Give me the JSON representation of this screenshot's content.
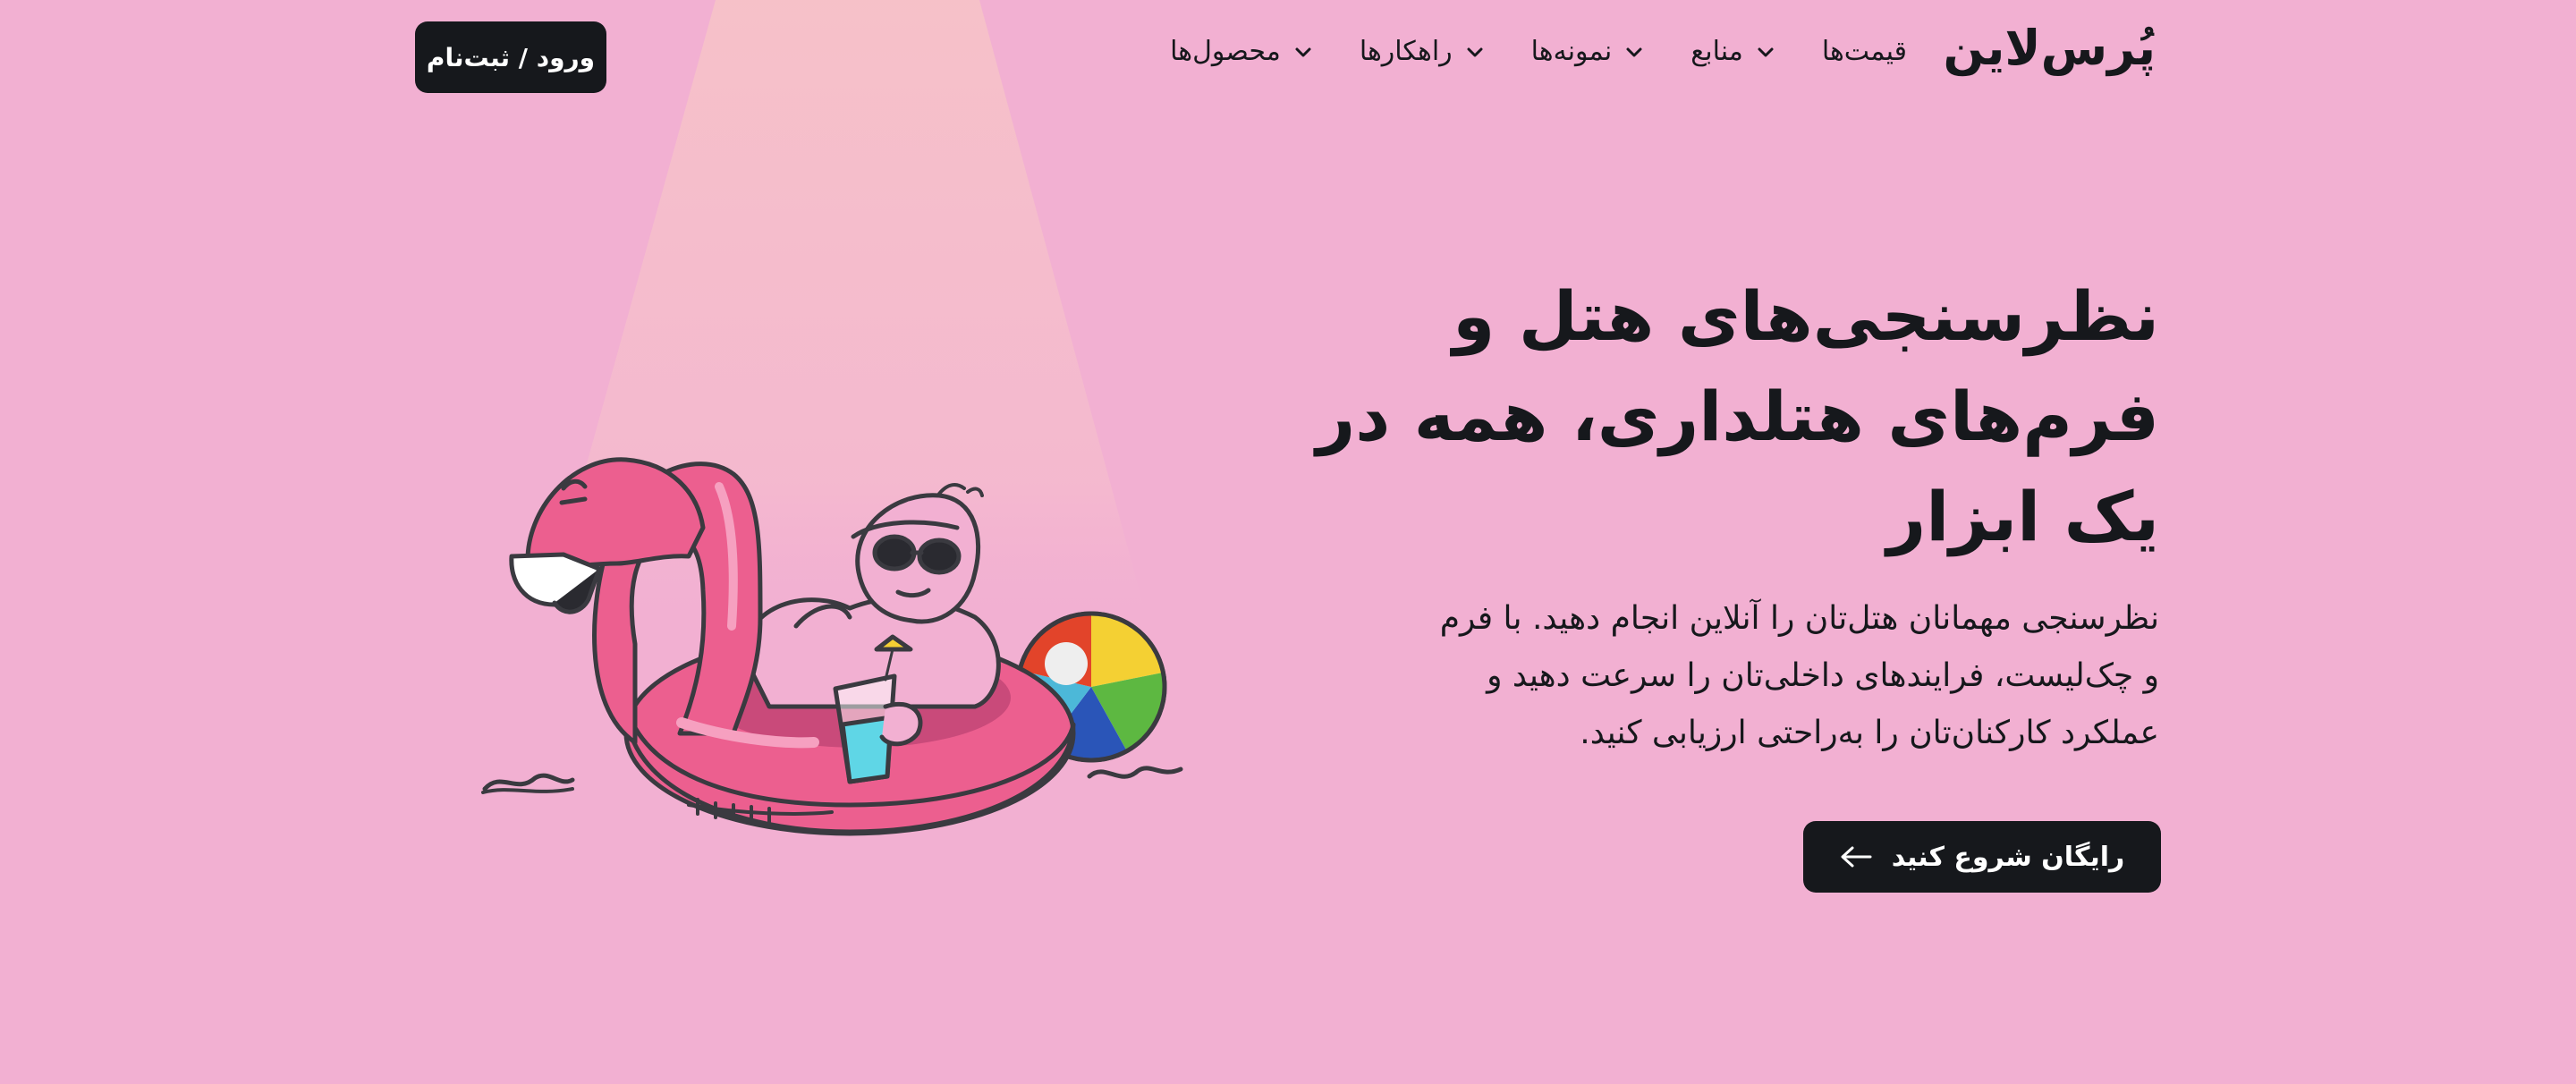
{
  "header": {
    "logo": "پُرس‌لاین",
    "nav": [
      {
        "label": "محصول‌ها"
      },
      {
        "label": "راهکارها"
      },
      {
        "label": "نمونه‌ها"
      },
      {
        "label": "منابع"
      },
      {
        "label": "قیمت‌ها"
      }
    ],
    "login_label": "ورود / ثبت‌نام"
  },
  "hero": {
    "title_lines": [
      "نظرسنجی‌های هتل و",
      "فرم‌های هتلداری، همه در",
      "یک ابزار"
    ],
    "description_lines": [
      "نظرسنجی مهمانان هتل‌تان را آنلاین انجام دهید. با فرم",
      "و چک‌لیست، فرایندهای داخلی‌تان را سرعت دهید و",
      "عملکرد کارکنان‌تان را به‌راحتی ارزیابی کنید."
    ],
    "cta_label": "رایگان شروع کنید"
  },
  "icons": {
    "nav_chevron": "chevron-down-icon",
    "cta_arrow": "arrow-left-icon"
  },
  "colors": {
    "background": "#f2b0d2",
    "dark": "#16181c",
    "flamingo": "#ec5f8f"
  }
}
